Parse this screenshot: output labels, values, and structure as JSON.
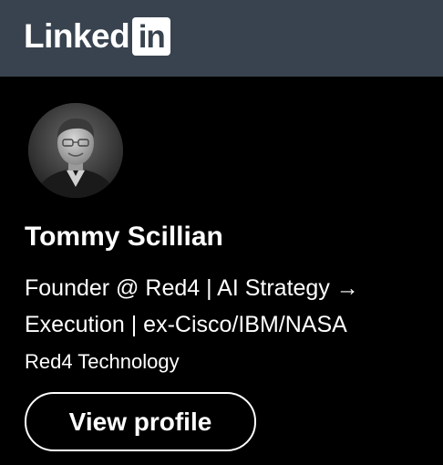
{
  "header": {
    "logo_text": "Linked",
    "logo_badge": "in"
  },
  "profile": {
    "name": "Tommy Scillian",
    "headline": "Founder @ Red4 | AI Strategy → Execution | ex-Cisco/IBM/NASA",
    "company": "Red4 Technology",
    "avatar_icon": "profile-photo",
    "view_button_label": "View profile"
  },
  "colors": {
    "header_bg": "#38434f",
    "card_bg": "#000000",
    "text": "#ffffff"
  }
}
